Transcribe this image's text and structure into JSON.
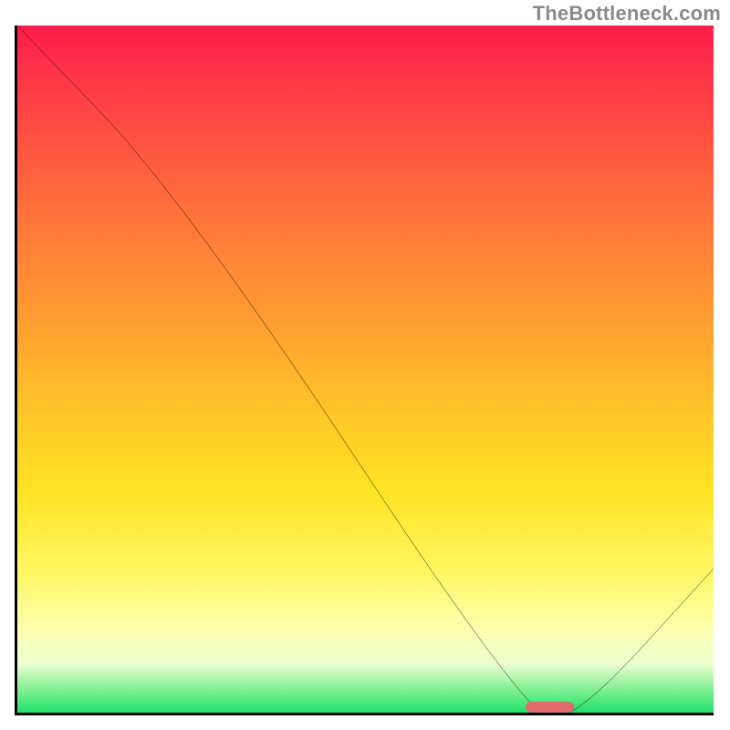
{
  "watermark": "TheBottleneck.com",
  "chart_data": {
    "type": "line",
    "title": "",
    "xlabel": "",
    "ylabel": "",
    "xlim": [
      0,
      100
    ],
    "ylim": [
      0,
      100
    ],
    "grid": false,
    "legend": false,
    "series": [
      {
        "name": "curve",
        "x": [
          0,
          24,
          73,
          80,
          100
        ],
        "values": [
          100,
          75,
          1,
          0,
          22
        ]
      }
    ],
    "annotations": [
      {
        "name": "optimal-range-marker",
        "kind": "hbar",
        "x_start": 73,
        "x_end": 80,
        "y": 0,
        "color": "#e26a6a"
      }
    ],
    "background_gradient": {
      "direction": "top-to-bottom",
      "stops": [
        {
          "pos": 0,
          "color": "#ff1a4b"
        },
        {
          "pos": 18,
          "color": "#ff5640"
        },
        {
          "pos": 44,
          "color": "#ffa030"
        },
        {
          "pos": 68,
          "color": "#ffe424"
        },
        {
          "pos": 88,
          "color": "#fdffb0"
        },
        {
          "pos": 96,
          "color": "#93f29c"
        },
        {
          "pos": 100,
          "color": "#1fe06a"
        }
      ]
    }
  }
}
